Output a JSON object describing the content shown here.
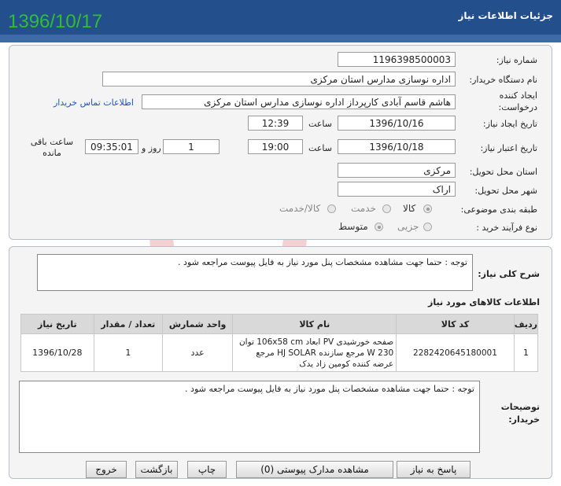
{
  "header": {
    "title": "جزئیات اطلاعات نیاز",
    "date_stamp": "1396/10/17"
  },
  "form": {
    "need_number_label": "شماره نیاز:",
    "need_number": "1196398500003",
    "buyer_label": "نام دستگاه خریدار:",
    "buyer": "اداره نوسازی مدارس استان مرکزی",
    "creator_label": "ایجاد کننده درخواست:",
    "creator": "هاشم  قاسم آبادی کارپرداز اداره نوسازی مدارس استان مرکزی",
    "contact_link": "اطلاعات تماس خریدار",
    "created_label": "تاریخ ایجاد نیاز:",
    "created_date": "1396/10/16",
    "time_label": "ساعت",
    "created_time": "12:39",
    "valid_label": "تاریخ اعتبار نیاز:",
    "valid_date": "1396/10/18",
    "valid_time": "19:00",
    "days": "1",
    "day_label": "روز و",
    "remaining": "09:35:01",
    "remaining_label": "ساعت باقی مانده",
    "province_label": "استان محل تحویل:",
    "province": "مرکزی",
    "city_label": "شهر محل تحویل:",
    "city": "اراک",
    "category_label": "طبقه بندی موضوعی:",
    "category_options": [
      "کالا",
      "خدمت",
      "کالا/خدمت"
    ],
    "process_label": "نوع فرآیند خرید :",
    "process_options": [
      "جزیی",
      "متوسط"
    ]
  },
  "summary": {
    "label": "شرح کلی نیاز:",
    "text": "توجه : حتما جهت مشاهده مشخصات پنل مورد نیاز به فایل پیوست مراجعه شود ."
  },
  "goods": {
    "title": "اطلاعات کالاهای مورد نیاز",
    "headers": [
      "ردیف",
      "کد کالا",
      "نام کالا",
      "واحد شمارش",
      "تعداد / مقدار",
      "تاریخ نیاز"
    ],
    "rows": [
      {
        "index": "1",
        "code": "2282420645180001",
        "name": "صفحه خورشیدی PV ابعاد 106x58 cm توان 230 W مرجع سازنده HJ SOLAR مرجع عرضه کننده کومین زاد یدک",
        "unit": "عدد",
        "qty": "1",
        "date": "1396/10/28"
      }
    ]
  },
  "notes": {
    "label": "توضیحات خریدار:",
    "text": "توجه : حتما جهت مشاهده مشخصات پنل مورد نیاز به فایل پیوست مراجعه شود ."
  },
  "buttons": {
    "reply": "پاسخ به نیاز",
    "attachments": "مشاهده مدارک پیوستی (0)",
    "print": "چاپ",
    "back": "بازگشت",
    "exit": "خروج"
  },
  "colors": {
    "header": "#234f8c",
    "date_stamp": "#2fbf2f",
    "link": "#1a55c4"
  }
}
